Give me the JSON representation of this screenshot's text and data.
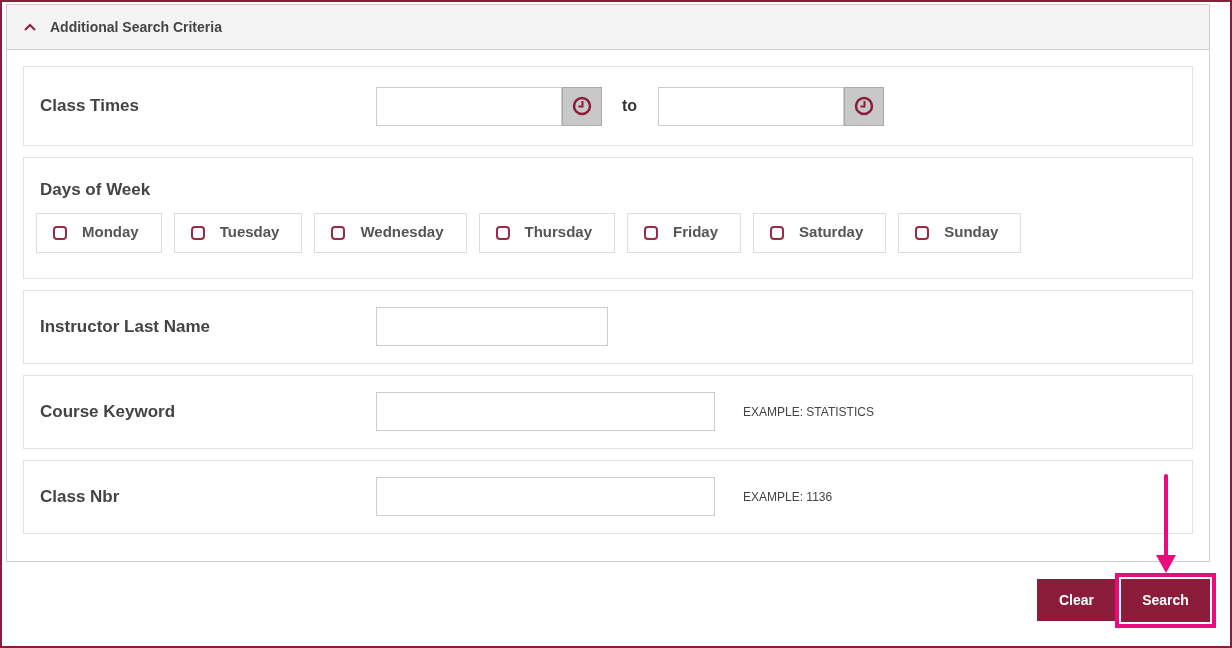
{
  "panel": {
    "title": "Additional Search Criteria",
    "expanded": true
  },
  "rows": [
    {
      "kind": "time_range",
      "label": "Class Times",
      "separator": "to"
    },
    {
      "kind": "days",
      "label": "Days of Week",
      "days": [
        {
          "label": "Monday",
          "checked": false
        },
        {
          "label": "Tuesday",
          "checked": false
        },
        {
          "label": "Wednesday",
          "checked": false
        },
        {
          "label": "Thursday",
          "checked": false
        },
        {
          "label": "Friday",
          "checked": false
        },
        {
          "label": "Saturday",
          "checked": false
        },
        {
          "label": "Sunday",
          "checked": false
        }
      ]
    },
    {
      "kind": "text",
      "label": "Instructor Last Name"
    },
    {
      "kind": "text",
      "label": "Course Keyword",
      "example": "EXAMPLE: STATISTICS"
    },
    {
      "kind": "text",
      "label": "Class Nbr",
      "example": "EXAMPLE: 1136"
    }
  ],
  "buttons": [
    {
      "label": "Clear",
      "highlighted": false
    },
    {
      "label": "Search",
      "highlighted": true
    }
  ]
}
